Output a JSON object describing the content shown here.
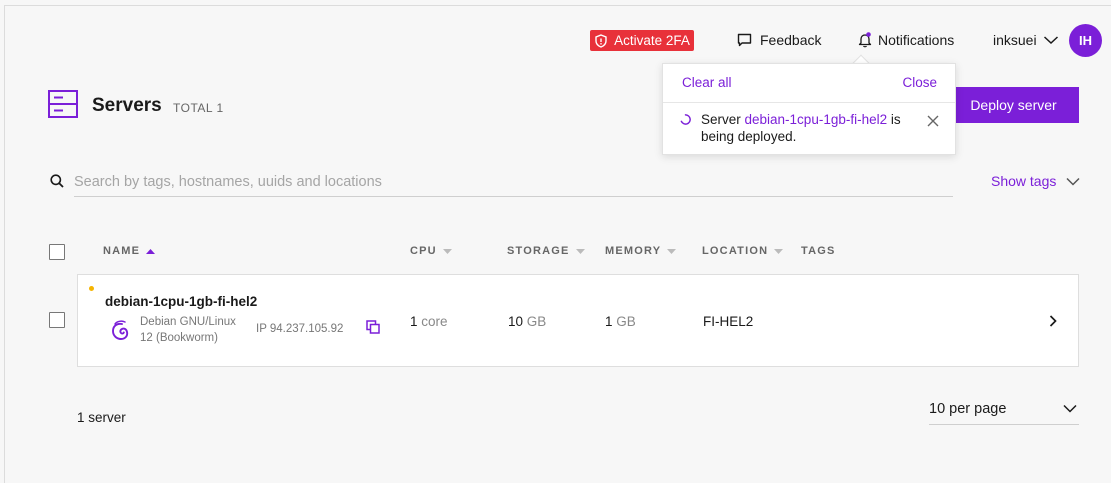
{
  "topbar": {
    "activate_2fa": "Activate 2FA",
    "feedback": "Feedback",
    "notifications": "Notifications",
    "username": "inksuei",
    "avatar_initials": "IH"
  },
  "header": {
    "title": "Servers",
    "total": "TOTAL 1",
    "deploy_button": "Deploy server"
  },
  "notifications_popup": {
    "clear_all": "Clear all",
    "close": "Close",
    "message_prefix": "Server ",
    "message_link": "debian-1cpu-1gb-fi-hel2",
    "message_suffix": " is being deployed."
  },
  "search": {
    "placeholder": "Search by tags, hostnames, uuids and locations",
    "show_tags": "Show tags"
  },
  "table": {
    "columns": [
      "NAME",
      "CPU",
      "STORAGE",
      "MEMORY",
      "LOCATION",
      "TAGS"
    ],
    "rows": [
      {
        "hostname": "debian-1cpu-1gb-fi-hel2",
        "os_line1": "Debian GNU/Linux",
        "os_line2": "12 (Bookworm)",
        "ip": "IP 94.237.105.92",
        "cpu_value": "1",
        "cpu_unit": "core",
        "storage_value": "10",
        "storage_unit": "GB",
        "memory_value": "1",
        "memory_unit": "GB",
        "location": "FI-HEL2"
      }
    ]
  },
  "footer": {
    "count": "1 server",
    "per_page": "10 per page"
  },
  "colors": {
    "accent": "#7b1fd8",
    "danger": "#e8313a",
    "status_deploying": "#f5b400"
  }
}
